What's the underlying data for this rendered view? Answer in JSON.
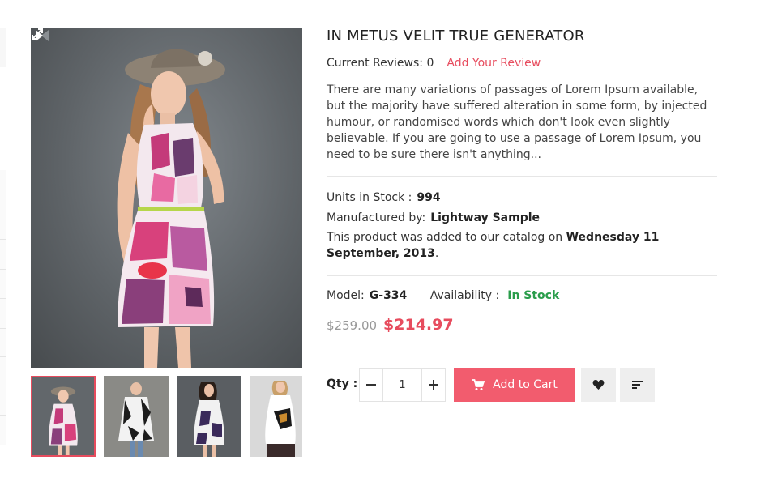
{
  "product": {
    "title": "IN METUS VELIT TRUE GENERATOR",
    "reviews_label": "Current Reviews: 0",
    "add_review": "Add Your Review",
    "description": "There are many variations of passages of Lorem Ipsum available, but the majority have suffered alteration in some form, by injected humour, or randomised words which don't look even slightly believable. If you are going to use a passage of Lorem Ipsum, you need to be sure there isn't anything...",
    "units_label": "Units in Stock :",
    "units_value": "994",
    "manufacturer_label": "Manufactured by:",
    "manufacturer_value": "Lightway Sample",
    "catalog_prefix": "This product was added to our catalog on",
    "catalog_date": "Wednesday 11 September, 2013",
    "catalog_suffix": ".",
    "model_label": "Model:",
    "model_value": "G-334",
    "availability_label": "Availability :",
    "availability_value": "In Stock",
    "old_price": "$259.00",
    "new_price": "$214.97"
  },
  "cart": {
    "qty_label": "Qty :",
    "qty_value": "1",
    "add_to_cart": "Add to Cart"
  },
  "gallery": {
    "thumbnail_count": 4,
    "active_thumbnail": 1
  },
  "colors": {
    "accent": "#f25c6e",
    "link": "#e74c5e",
    "in_stock": "#2a9d4b",
    "old_price": "#999999"
  },
  "icons": {
    "expand": "expand-icon",
    "prev": "chevron-left-icon",
    "next": "chevron-right-icon",
    "minus": "minus-icon",
    "plus": "plus-icon",
    "cart": "cart-icon",
    "wishlist": "heart-icon",
    "compare": "sort-icon"
  }
}
